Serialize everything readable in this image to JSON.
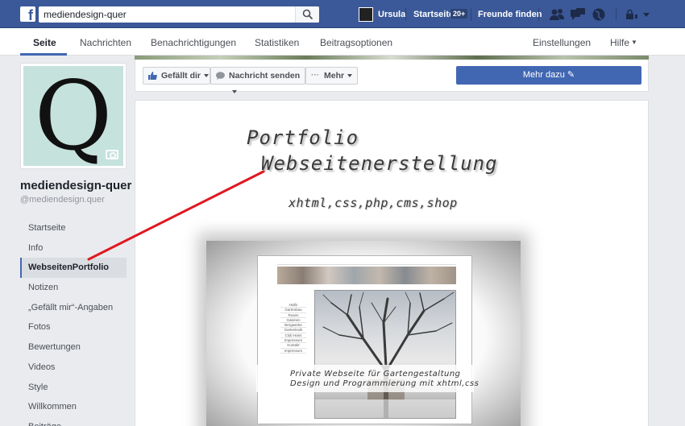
{
  "topbar": {
    "search_value": "mediendesign-quer",
    "user_name": "Ursula",
    "home_label": "Startseite",
    "home_badge": "20+",
    "friends_label": "Freunde finden"
  },
  "page_nav": {
    "tabs": [
      {
        "label": "Seite"
      },
      {
        "label": "Nachrichten"
      },
      {
        "label": "Benachrichtigungen"
      },
      {
        "label": "Statistiken"
      },
      {
        "label": "Beitragsoptionen"
      }
    ],
    "settings_label": "Einstellungen",
    "help_label": "Hilfe"
  },
  "profile": {
    "letter": "Q",
    "name": "mediendesign-quer",
    "handle": "@mediendesign.quer"
  },
  "side_menu": [
    {
      "label": "Startseite"
    },
    {
      "label": "Info"
    },
    {
      "label": "WebseitenPortfolio"
    },
    {
      "label": "Notizen"
    },
    {
      "label": "„Gefällt mir“-Angaben"
    },
    {
      "label": "Fotos"
    },
    {
      "label": "Bewertungen"
    },
    {
      "label": "Videos"
    },
    {
      "label": "Style"
    },
    {
      "label": "Willkommen"
    },
    {
      "label": "Beiträge"
    }
  ],
  "actions": {
    "like_label": "Gefällt dir",
    "message_label": "Nachricht senden",
    "more_label": "Mehr",
    "learn_more_label": "Mehr dazu"
  },
  "post": {
    "line1": "Portfolio",
    "line2": "Webseitenerstellung",
    "line3": "xhtml,css,php,cms,shop",
    "mini_nav": [
      "Hallo",
      "Gartenbau",
      "Rosen",
      "Galerien",
      "Bergwerke",
      "Gartenlexik",
      "Club Hans",
      "Impressum",
      "Kontakt",
      "Impressum"
    ],
    "caption1": "Private Webseite für Gartengestaltung",
    "caption2": "Design und Programmierung mit xhtml,css"
  },
  "colors": {
    "brand_blue": "#3b5998",
    "button_blue": "#4267b2",
    "arrow_red": "#e0171f"
  }
}
